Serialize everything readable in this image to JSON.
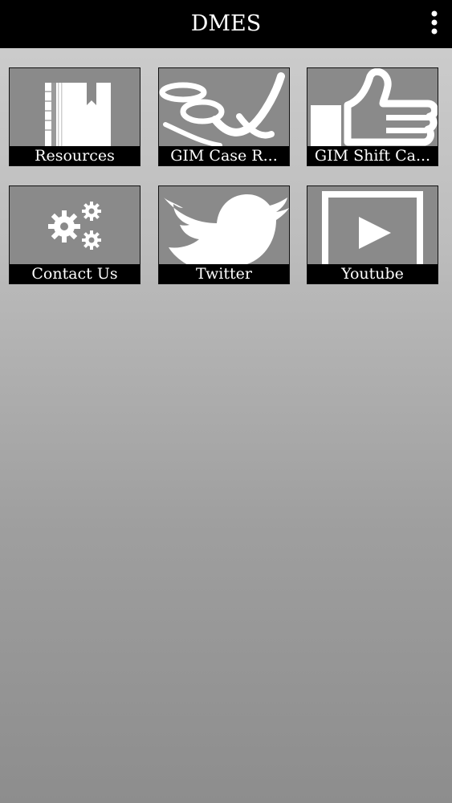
{
  "app_bar": {
    "title": "DMES",
    "menu_icon": "more-vert-icon"
  },
  "tiles": [
    {
      "label": "Resources",
      "icon": "book-icon"
    },
    {
      "label": "GIM Case R...",
      "icon": "signature-icon"
    },
    {
      "label": "GIM Shift Ca...",
      "icon": "thumbs-up-icon"
    },
    {
      "label": "Contact Us",
      "icon": "gears-icon"
    },
    {
      "label": "Twitter",
      "icon": "twitter-bird-icon"
    },
    {
      "label": "Youtube",
      "icon": "play-icon"
    }
  ],
  "colors": {
    "app_bar": "#000000",
    "caption_bar": "#000000",
    "tile_background": "#8a8a8a",
    "icon": "#ffffff",
    "page_gradient_top": "#cfcfcf",
    "page_gradient_bottom": "#8d8d8d"
  }
}
